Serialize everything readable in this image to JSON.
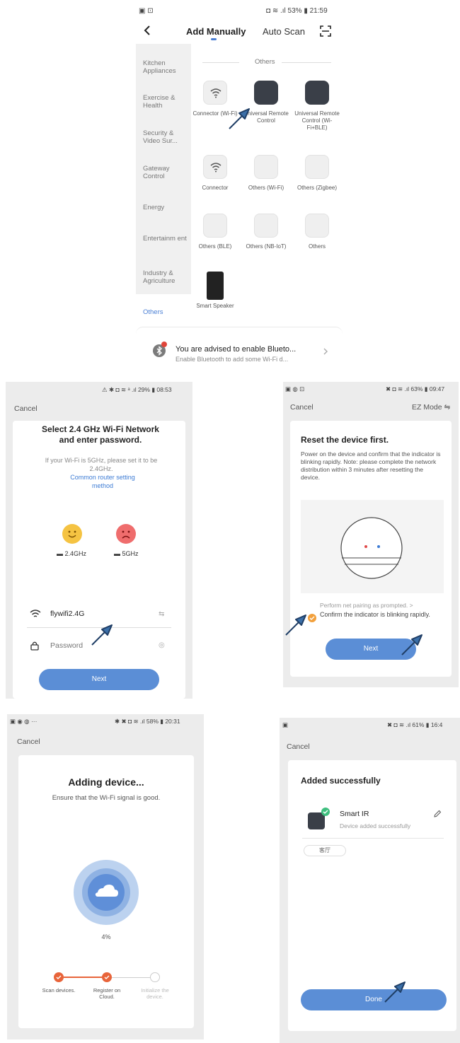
{
  "panel1": {
    "status_left": "▣ ⊡",
    "status_right": "◘ ≋ .ıl 53% ▮ 21:59",
    "tabs": {
      "add_manually": "Add Manually",
      "auto_scan": "Auto Scan"
    },
    "categories": [
      "Kitchen Appliances",
      "Exercise & Health",
      "Security & Video Sur...",
      "Gateway Control",
      "Energy",
      "Entertainm ent",
      "Industry & Agriculture",
      "Others"
    ],
    "section_title": "Others",
    "devices": [
      "Connector (Wi-Fi)",
      "Universal Remote Control",
      "Universal Remote Control (Wi-Fi+BLE)",
      "Connector",
      "Others (Wi-Fi)",
      "Others (Zigbee)",
      "Others (BLE)",
      "Others (NB-IoT)",
      "Others",
      "Smart Speaker"
    ],
    "notice_title": "You are advised to enable Blueto...",
    "notice_sub": "Enable Bluetooth to add some Wi-Fi d..."
  },
  "panel2": {
    "status_right": "⚠ ✱ ◘ ≋ ᵃ .ıl 29% ▮ 08:53",
    "cancel": "Cancel",
    "title": "Select 2.4 GHz Wi-Fi Network and enter password.",
    "desc": "If your Wi-Fi is 5GHz, please set it to be 2.4GHz.",
    "link": "Common router setting method",
    "band_good": "2.4GHz",
    "band_bad": "5GHz",
    "wifi_name": "flywifi2.4G",
    "password_placeholder": "Password",
    "next": "Next"
  },
  "panel3": {
    "status_left": "▣ ◍ ⊡",
    "status_right": "✖ ◘ ≋ .ıl 63% ▮ 09:47",
    "cancel": "Cancel",
    "mode": "EZ Mode ⇋",
    "title": "Reset the device first.",
    "desc": "Power on the device and confirm that the indicator is blinking rapidly. Note: please complete the network distribution within 3 minutes after resetting the device.",
    "perform": "Perform net pairing as prompted. >",
    "confirm": "Confirm the indicator is blinking rapidly.",
    "next": "Next"
  },
  "panel4": {
    "status_left": "▣ ◉ ◍ ···",
    "status_right": "✱ ✖ ◘ ≋ .ıl 58% ▮ 20:31",
    "cancel": "Cancel",
    "title": "Adding device...",
    "sub": "Ensure that the Wi-Fi signal is good.",
    "progress_label": "4%",
    "progress_value": 4,
    "steps": [
      "Scan devices.",
      "Register on Cloud.",
      "Initialize the device."
    ]
  },
  "panel5": {
    "status_left": "▣",
    "status_right": "✖ ◘ ≋ .ıl 61% ▮ 16:4",
    "cancel": "Cancel",
    "title": "Added successfully",
    "device_name": "Smart IR",
    "device_sub": "Device added successfully",
    "room_chip": "客厅",
    "done": "Done"
  }
}
